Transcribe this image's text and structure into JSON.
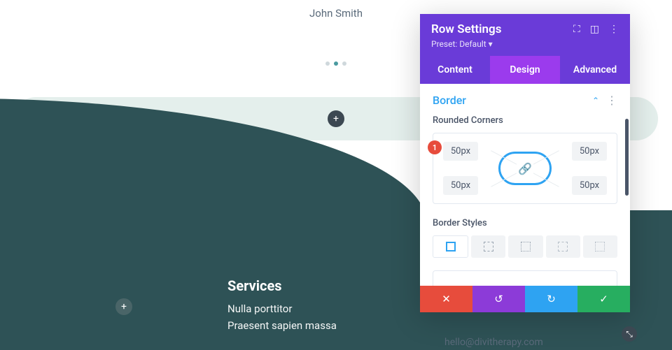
{
  "canvas": {
    "author_name": "John Smith",
    "services_heading": "Services",
    "services_line1": "Nulla porttitor",
    "services_line2": "Praesent sapien massa",
    "email_hint": "hello@divitherapy.com"
  },
  "panel": {
    "title": "Row Settings",
    "preset_label": "Preset: Default",
    "tabs": {
      "content": "Content",
      "design": "Design",
      "advanced": "Advanced"
    },
    "section": {
      "title": "Border",
      "rounded_label": "Rounded Corners",
      "corners": {
        "tl": "50px",
        "tr": "50px",
        "bl": "50px",
        "br": "50px"
      },
      "styles_label": "Border Styles",
      "badge": "1"
    }
  }
}
